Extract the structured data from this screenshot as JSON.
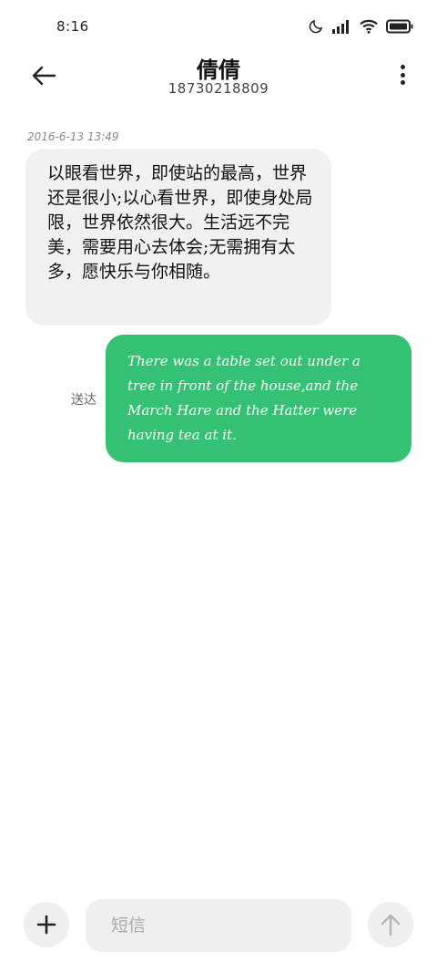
{
  "status_bar": {
    "time": "8:16",
    "icons": [
      "moon-icon",
      "signal-icon",
      "wifi-icon",
      "battery-icon"
    ]
  },
  "header": {
    "contact_name": "倩倩",
    "contact_number": "18730218809",
    "back_icon": "arrow-left-icon",
    "more_icon": "more-vertical-icon"
  },
  "conversation": {
    "timestamp": "2016-6-13 13:49",
    "incoming": {
      "text": "以眼看世界，即使站的最高，世界还是很小;以心看世界，即使身处局限，世界依然很大。生活远不完美，需要用心去体会;无需拥有太多，愿快乐与你相随。"
    },
    "outgoing": {
      "text": "There was a table set out under a tree in front of the house,and the March Hare and the Hatter were having tea at it.",
      "status": "送达"
    }
  },
  "composer": {
    "placeholder": "短信",
    "add_icon": "plus-icon",
    "send_icon": "arrow-up-icon"
  },
  "colors": {
    "outgoing_bubble": "#34c173",
    "incoming_bubble": "#f1f1f1",
    "background": "#ffffff"
  }
}
